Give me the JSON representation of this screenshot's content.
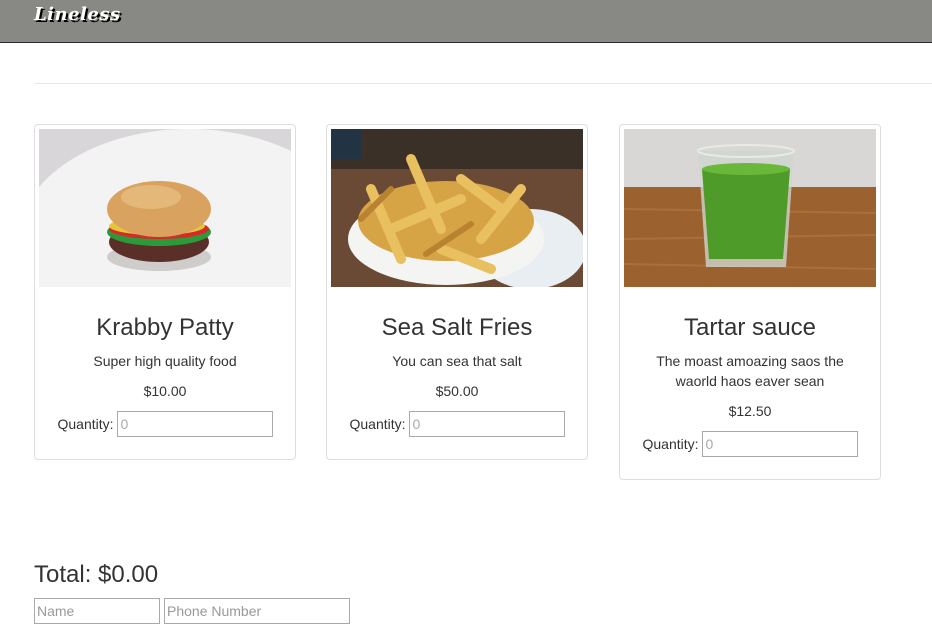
{
  "navbar": {
    "brand": "Lineless"
  },
  "products": [
    {
      "name": "Krabby Patty",
      "description": "Super high quality food",
      "price": "$10.00",
      "quantity_label": "Quantity:",
      "quantity_placeholder": "0"
    },
    {
      "name": "Sea Salt Fries",
      "description": "You can sea that salt",
      "price": "$50.00",
      "quantity_label": "Quantity:",
      "quantity_placeholder": "0"
    },
    {
      "name": "Tartar sauce",
      "description": "The moast amoazing saos the waorld haos eaver sean",
      "price": "$12.50",
      "quantity_label": "Quantity:",
      "quantity_placeholder": "0"
    }
  ],
  "order": {
    "total": "Total: $0.00",
    "name_placeholder": "Name",
    "phone_placeholder": "Phone Number"
  },
  "colors": {
    "navbar": "#888884",
    "brand_text": "#ffffff",
    "card_border": "#dddddd"
  }
}
